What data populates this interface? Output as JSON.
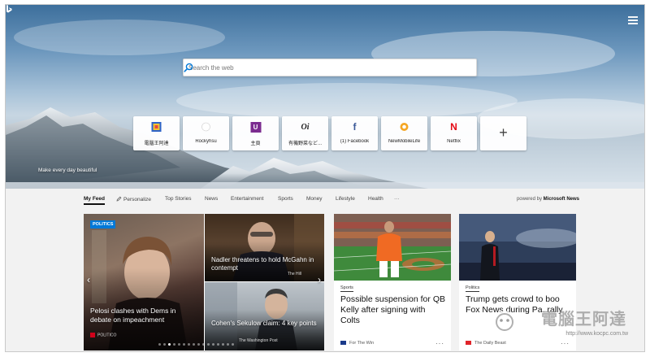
{
  "header": {
    "menu_icon": "hamburger-icon"
  },
  "search": {
    "placeholder": "Search the web",
    "icon": "search-icon"
  },
  "top_sites": [
    {
      "label": "電腦王阿達",
      "icon": "kocpc-icon",
      "color": "#e8473f"
    },
    {
      "label": "Rockyhsu",
      "icon": "rockyhsu-icon",
      "color": "#888888"
    },
    {
      "label": "主頁",
      "icon": "u-letter-icon",
      "glyph": "U",
      "color": "#7b2c8f"
    },
    {
      "label": "有機野菜など...",
      "icon": "oi-icon",
      "glyph": "Oi",
      "color": "#222222"
    },
    {
      "label": "(1) Facebook",
      "icon": "facebook-icon",
      "glyph": "f",
      "color": "#3b5998"
    },
    {
      "label": "NewMobileLife",
      "icon": "newmobilelife-icon",
      "color": "#f5a623"
    },
    {
      "label": "Netflix",
      "icon": "netflix-icon",
      "glyph": "N",
      "color": "#e50914"
    }
  ],
  "add_tile": {
    "glyph": "+"
  },
  "hero": {
    "tagline": "Make every day beautiful",
    "logo": "bing-icon"
  },
  "feed_nav": {
    "items": [
      {
        "label": "My Feed",
        "active": true
      },
      {
        "label": "Personalize",
        "icon": "pencil-icon"
      },
      {
        "label": "Top Stories"
      },
      {
        "label": "News"
      },
      {
        "label": "Entertainment"
      },
      {
        "label": "Sports"
      },
      {
        "label": "Money"
      },
      {
        "label": "Lifestyle"
      },
      {
        "label": "Health"
      },
      {
        "label": "···"
      }
    ],
    "powered_prefix": "powered by",
    "powered_brand": "Microsoft News"
  },
  "hero_card": {
    "badge": "POLITICS",
    "left": {
      "title": "Pelosi clashes with Dems in debate on impeachment",
      "source": "POLITICO"
    },
    "right_top": {
      "title": "Nadler threatens to hold McGahn in contempt",
      "source": "The Hill"
    },
    "right_bottom": {
      "title": "Cohen's Sekulow claim: 4 key points",
      "source": "The Washington Post"
    },
    "prev_glyph": "‹",
    "next_glyph": "›",
    "dot_count": 16,
    "active_dot": 2
  },
  "cards": [
    {
      "category": "Sports",
      "title": "Possible suspension for QB Kelly after signing with Colts",
      "source": "For The Win",
      "more": "···"
    },
    {
      "category": "Politics",
      "title": "Trump gets crowd to boo Fox News during Pa. rally",
      "source": "The Daily Beast",
      "more": "···"
    }
  ],
  "watermark": {
    "text": "電腦王阿達",
    "url": "http://www.kocpc.com.tw"
  },
  "colors": {
    "accent": "#0078d7",
    "badge": "#0078d7"
  }
}
